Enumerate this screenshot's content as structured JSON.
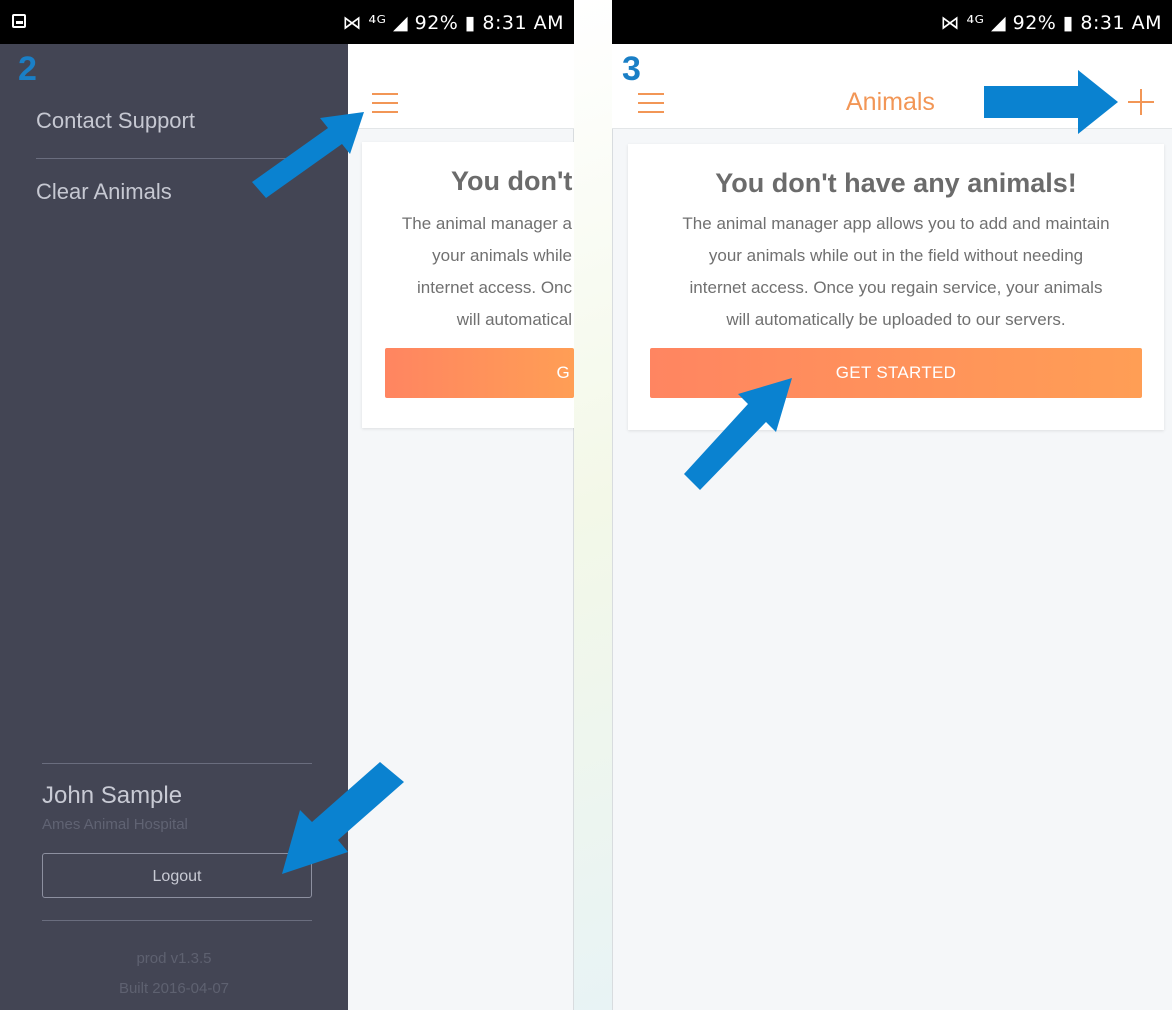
{
  "status_bar": {
    "text": "⋈ ⁴ᴳ ◢ 92% ▮ 8:31 AM"
  },
  "screen_2": {
    "step_label": "2",
    "drawer": {
      "items": [
        {
          "label": "Contact Support"
        },
        {
          "label": "Clear Animals"
        }
      ],
      "user_name": "John Sample",
      "user_org": "Ames Animal Hospital",
      "logout_label": "Logout",
      "version": "prod v1.3.5",
      "build": "Built 2016-04-07"
    },
    "card": {
      "title": "You don't",
      "desc_lines": [
        "The animal manager a",
        "your animals while",
        "internet access. Onc",
        "will automatical"
      ],
      "cta_label": "G"
    }
  },
  "screen_3": {
    "step_label": "3",
    "appbar": {
      "title": "Animals"
    },
    "card": {
      "title": "You don't have any animals!",
      "desc_lines": [
        "The animal manager app allows you to add and maintain",
        "your animals while out in the field without needing",
        "internet access. Once you regain service, your animals",
        "will automatically be uploaded to our servers."
      ],
      "cta_label": "GET STARTED"
    }
  },
  "colors": {
    "accent": "#f29656",
    "drawer_bg": "#434554",
    "arrow": "#0a82d0",
    "step_label": "#1a7fc6"
  },
  "icons": [
    "menu-icon",
    "plus-icon",
    "arrow-icon",
    "photo-icon"
  ]
}
